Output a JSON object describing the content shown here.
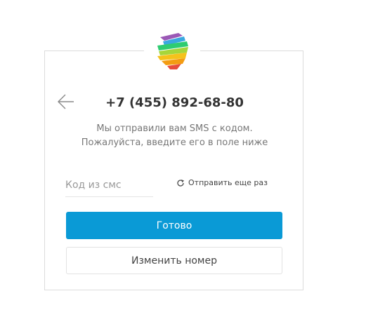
{
  "logo": {
    "icon": "ribbon-logo-icon"
  },
  "header": {
    "back_icon": "arrow-left-icon",
    "phone": "+7 (455) 892-68-80"
  },
  "message": {
    "line1": "Мы отправили вам SMS с кодом.",
    "line2": "Пожалуйста, введите его в поле ниже"
  },
  "form": {
    "code_placeholder": "Код из смс",
    "code_value": "",
    "resend_icon": "refresh-icon",
    "resend_label": "Отправить еще раз",
    "submit_label": "Готово",
    "change_label": "Изменить номер"
  },
  "colors": {
    "primary": "#0a9ad6",
    "border": "#dcdcdc",
    "text_dark": "#333333",
    "text_muted": "#777777"
  }
}
